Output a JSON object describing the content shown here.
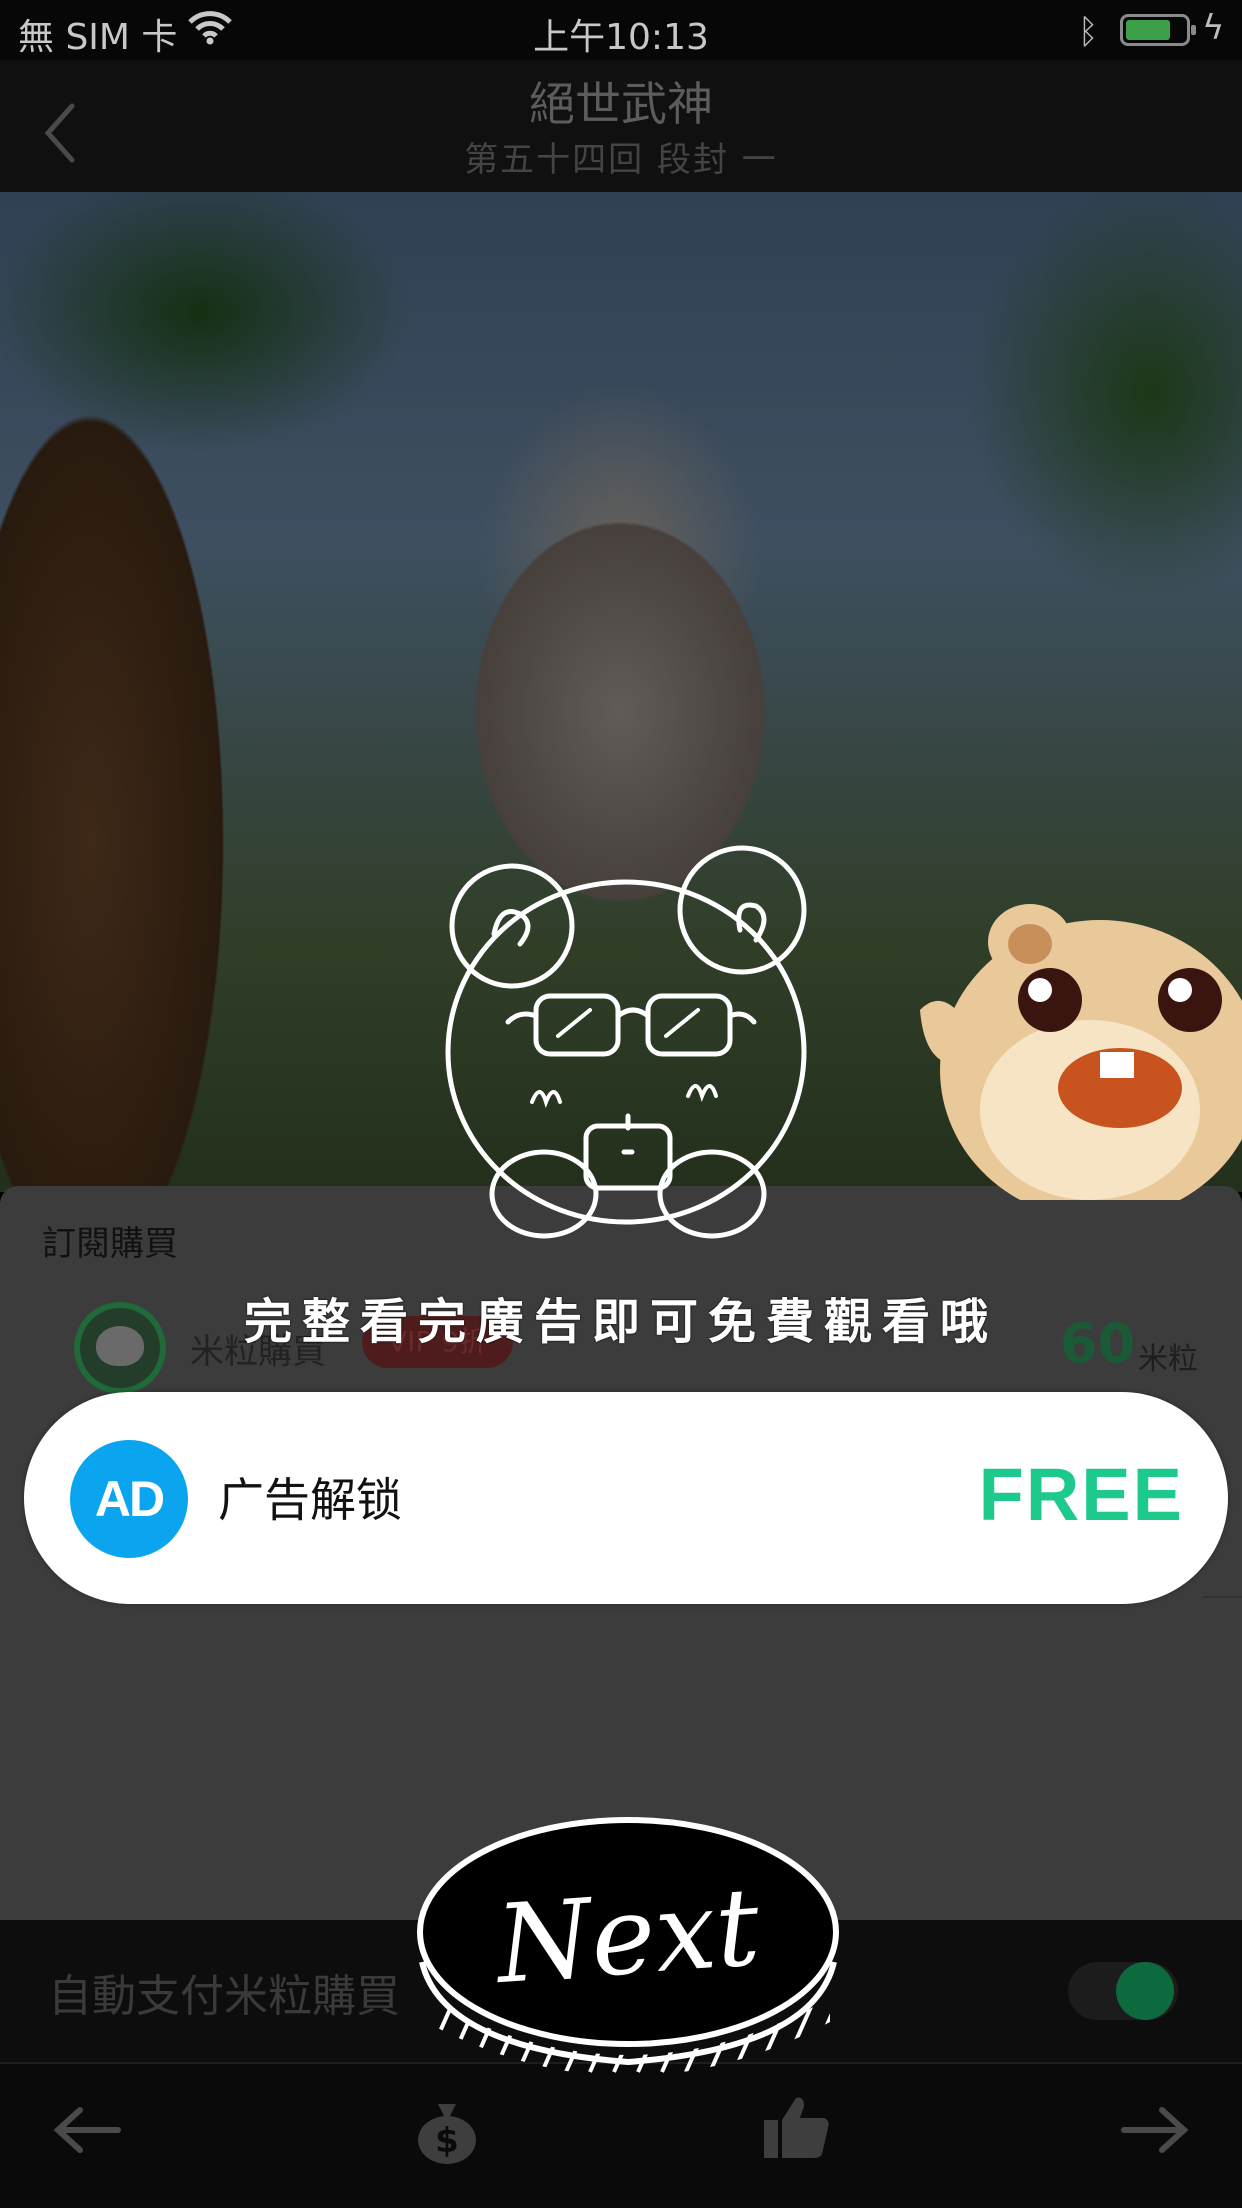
{
  "status_bar": {
    "carrier": "無 SIM 卡",
    "time": "上午10:13"
  },
  "nav": {
    "title": "絕世武神",
    "subtitle": "第五十四回  段封 一"
  },
  "purchase_sheet": {
    "title": "訂閱購買",
    "option": {
      "label": "米粒購買",
      "badge": "VIP 9折",
      "price": "60",
      "unit": "米粒"
    },
    "auto_pay_label": "自動支付米粒購買"
  },
  "overlay": {
    "hint": "完整看完廣告即可免費觀看哦",
    "ad_option": {
      "badge": "AD",
      "label": "广告解锁",
      "price_tag": "FREE"
    },
    "next_label": "Next"
  },
  "colors": {
    "accent_green": "#1ec98c",
    "ad_blue": "#0aa5ee"
  },
  "icons": [
    "wifi-icon",
    "bluetooth-icon",
    "battery-icon",
    "charging-icon",
    "back-icon",
    "arrow-left-icon",
    "money-bag-icon",
    "thumbs-up-icon",
    "arrow-right-icon"
  ]
}
